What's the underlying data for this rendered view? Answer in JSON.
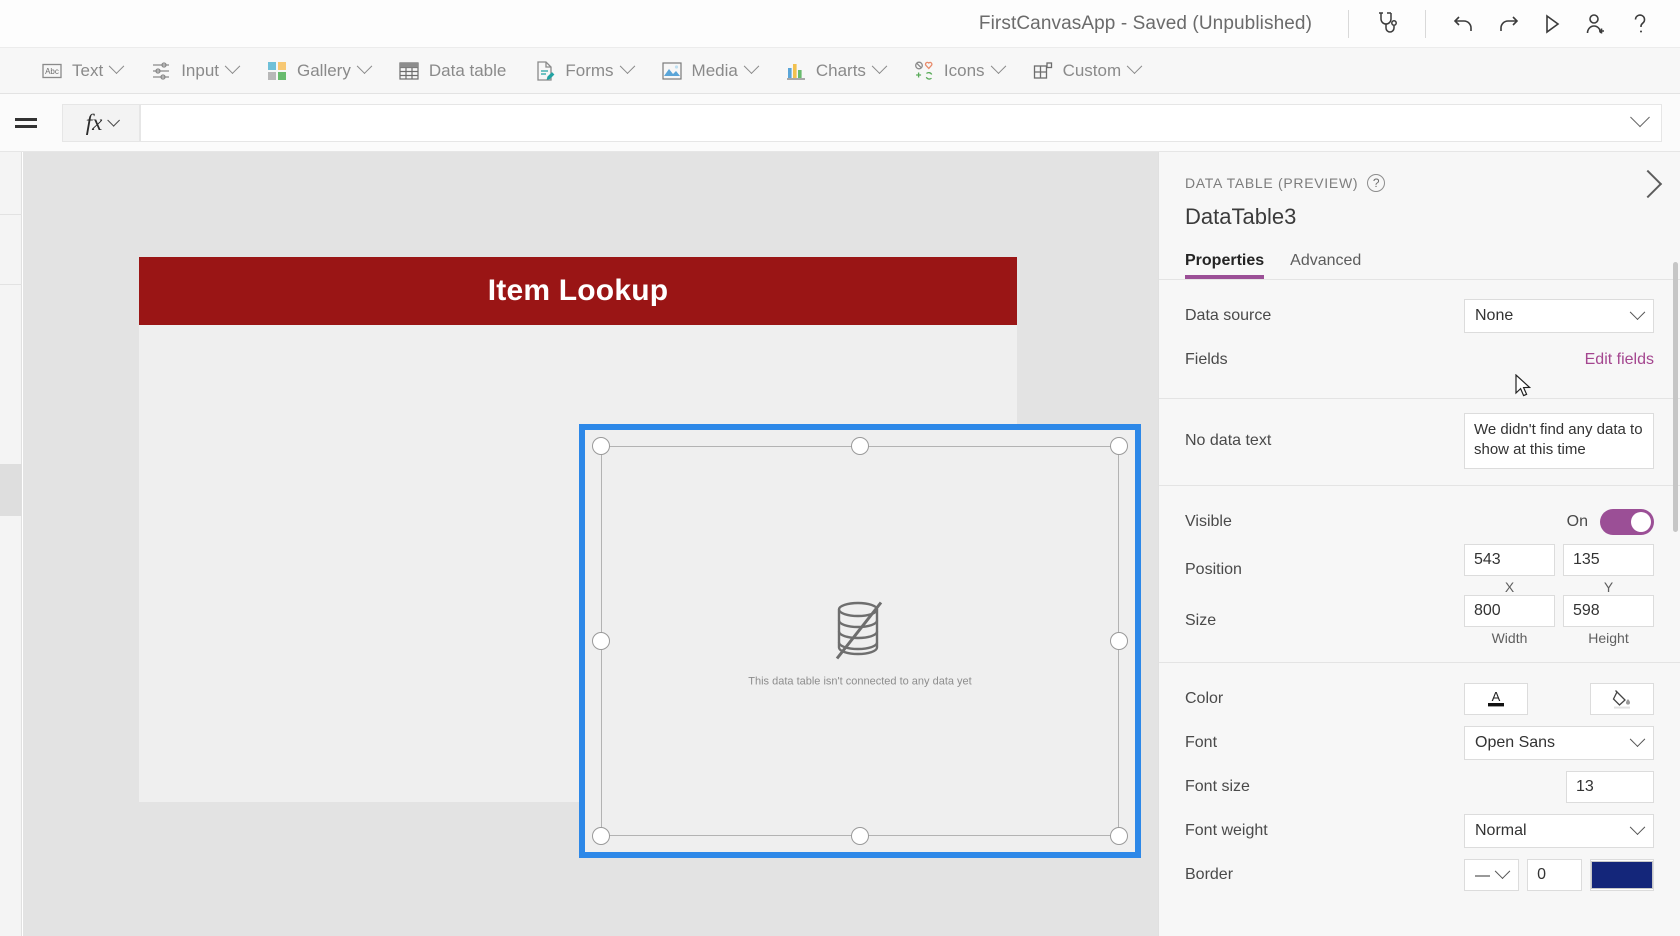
{
  "titlebar": {
    "app_title": "FirstCanvasApp - Saved (Unpublished)",
    "icons": [
      {
        "name": "app-checker-icon",
        "label": "App checker"
      },
      {
        "name": "undo-icon",
        "label": "Undo"
      },
      {
        "name": "redo-icon",
        "label": "Redo"
      },
      {
        "name": "preview-play-icon",
        "label": "Preview the app"
      },
      {
        "name": "share-person-icon",
        "label": "Share"
      },
      {
        "name": "help-question-icon",
        "label": "Help"
      }
    ]
  },
  "toolbar": {
    "items": [
      {
        "label": "Text",
        "icon": "text-abc-icon",
        "caret": true
      },
      {
        "label": "Input",
        "icon": "input-sliders-icon",
        "caret": true
      },
      {
        "label": "Gallery",
        "icon": "gallery-grid-icon",
        "caret": true
      },
      {
        "label": "Data table",
        "icon": "data-table-icon",
        "caret": false
      },
      {
        "label": "Forms",
        "icon": "forms-document-icon",
        "caret": true
      },
      {
        "label": "Media",
        "icon": "media-image-icon",
        "caret": true
      },
      {
        "label": "Charts",
        "icon": "charts-bar-icon",
        "caret": true
      },
      {
        "label": "Icons",
        "icon": "icons-shapes-icon",
        "caret": true
      },
      {
        "label": "Custom",
        "icon": "custom-blocks-icon",
        "caret": true
      }
    ]
  },
  "formula_bar": {
    "fx_label": "fx",
    "value": "",
    "placeholder": ""
  },
  "canvas": {
    "banner_title": "Item Lookup",
    "placeholder_caption": "This data table isn't connected to any data yet",
    "selection_color": "#2d88e8",
    "banner_color": "#9a1515"
  },
  "panel": {
    "kicker": "DATA TABLE (PREVIEW)",
    "control_name": "DataTable3",
    "tabs": [
      {
        "label": "Properties",
        "active": true
      },
      {
        "label": "Advanced",
        "active": false
      }
    ],
    "accent_color": "#9b4f96",
    "properties": {
      "data_source": {
        "label": "Data source",
        "value": "None"
      },
      "fields": {
        "label": "Fields",
        "action": "Edit fields"
      },
      "no_data_text": {
        "label": "No data text",
        "value": "We didn't find any data to show at this time"
      },
      "visible": {
        "label": "Visible",
        "state": "On"
      },
      "position": {
        "label": "Position",
        "x": "543",
        "y": "135",
        "x_sub": "X",
        "y_sub": "Y"
      },
      "size": {
        "label": "Size",
        "width": "800",
        "height": "598",
        "width_sub": "Width",
        "height_sub": "Height"
      },
      "color": {
        "label": "Color",
        "text_btn": "A",
        "fill_btn": "fill-bucket-icon"
      },
      "font": {
        "label": "Font",
        "value": "Open Sans"
      },
      "font_size": {
        "label": "Font size",
        "value": "13"
      },
      "font_weight": {
        "label": "Font weight",
        "value": "Normal"
      },
      "border": {
        "label": "Border",
        "style": "—",
        "thickness": "0",
        "color": "#14267a"
      }
    }
  }
}
